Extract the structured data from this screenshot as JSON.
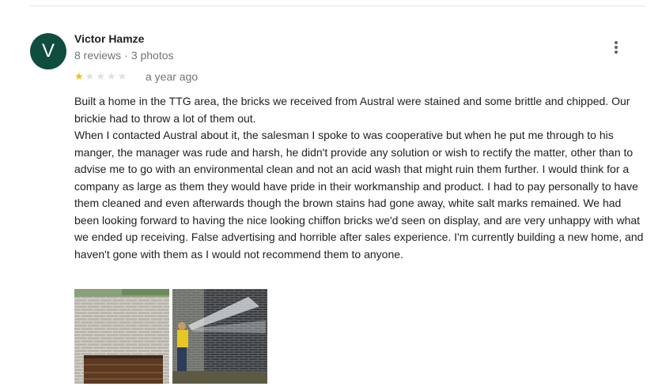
{
  "review": {
    "author_initial": "V",
    "author_name": "Victor Hamze",
    "reviews_count": "8 reviews",
    "separator": "·",
    "photos_count": "3 photos",
    "rating": 1,
    "rating_max": 5,
    "time_ago": "a year ago",
    "text": "Built a home in the TTG area, the bricks we received from Austral were stained and some brittle and chipped. Our brickie had to throw a lot of them out.\nWhen I contacted Austral about it, the salesman I spoke to was cooperative but when he put me through to his manger, the manager was rude and harsh, he didn't provide any solution or wish to rectify the matter, other than to advise me to go with an environmental clean and not an acid wash that might ruin them further. I would think for a company as large as them they would have pride in their workmanship and product. I had to pay personally to have them cleaned and even afterwards though the brown stains had gone away, white salt marks remained. We had been looking forward to having the nice looking chiffon bricks we'd seen on display, and are very unhappy with what we ended up receiving. False advertising and horrible after sales experience. I'm currently building a new home, and haven't gone with them as I would not recommend them to anyone.",
    "photos": [
      {
        "icon": "photo-brick-wall-garage"
      },
      {
        "icon": "photo-pressure-washing-wall"
      }
    ]
  },
  "colors": {
    "avatar_bg": "#0f4d3f",
    "star_filled": "#fbbc04",
    "star_empty": "#e0e0e0",
    "secondary_text": "#70757a"
  }
}
